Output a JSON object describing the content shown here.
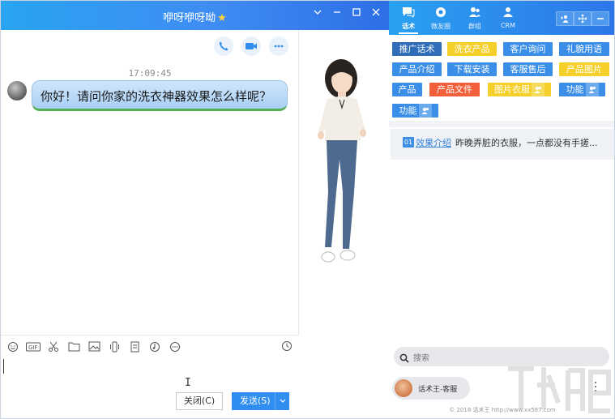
{
  "window": {
    "title": "咿呀咿呀呦",
    "title_star": "★",
    "controls": [
      "chevron-down-icon",
      "minimize-icon",
      "maximize-icon",
      "close-icon"
    ]
  },
  "chat": {
    "timestamp": "17:09:45",
    "message": "你好！请问你家的洗衣神器效果怎么样呢？",
    "call_buttons": [
      "phone-icon",
      "video-icon",
      "more-icon"
    ]
  },
  "toolbar": {
    "icons": [
      "emoji-icon",
      "gif-icon",
      "scissors-icon",
      "folder-icon",
      "image-icon",
      "shake-icon",
      "file-icon",
      "music-icon",
      "more-icon"
    ],
    "gif_label": "GIF",
    "clock": "clock-icon"
  },
  "input": {
    "close_label": "关闭(C)",
    "send_label": "发送(S)"
  },
  "right_panel": {
    "tabs": [
      {
        "label": "话术",
        "icon": "chat-icon",
        "active": true
      },
      {
        "label": "微友圈",
        "icon": "moments-icon",
        "active": false
      },
      {
        "label": "群组",
        "icon": "group-icon",
        "active": false
      },
      {
        "label": "CRM",
        "icon": "crm-icon",
        "active": false
      }
    ],
    "tools": [
      "add-user-icon",
      "move-icon",
      "minus-icon"
    ],
    "tags": [
      {
        "label": "推广话术",
        "color": "#2f6db8",
        "person": false
      },
      {
        "label": "洗衣产品",
        "color": "#f5cf2a",
        "person": false
      },
      {
        "label": "客户询问",
        "color": "#3b8ee8",
        "person": false
      },
      {
        "label": "礼貌用语",
        "color": "#3b8ee8",
        "person": false
      },
      {
        "label": "产品介绍",
        "color": "#3b8ee8",
        "person": false
      },
      {
        "label": "下载安装",
        "color": "#3b8ee8",
        "person": false
      },
      {
        "label": "客服售后",
        "color": "#3b8ee8",
        "person": false
      },
      {
        "label": "产品图片",
        "color": "#f5cf2a",
        "person": false
      },
      {
        "label": "产品",
        "color": "#3b8ee8",
        "person": false
      },
      {
        "label": "产品文件",
        "color": "#f1603a",
        "person": false
      },
      {
        "label": "图片衣服",
        "color": "#f5cf2a",
        "person": true
      },
      {
        "label": "功能",
        "color": "#3b8ee8",
        "person": true
      },
      {
        "label": "功能",
        "color": "#3b8ee8",
        "person": true
      }
    ],
    "script_item": {
      "number": "01",
      "link": "效果介绍",
      "text": "昨晚弄脏的衣服，一点都没有手搓..."
    },
    "search_placeholder": "搜索",
    "contact_name": "话术王-客服",
    "footer": "© 2018 话术王 http://www.xx587.com"
  }
}
